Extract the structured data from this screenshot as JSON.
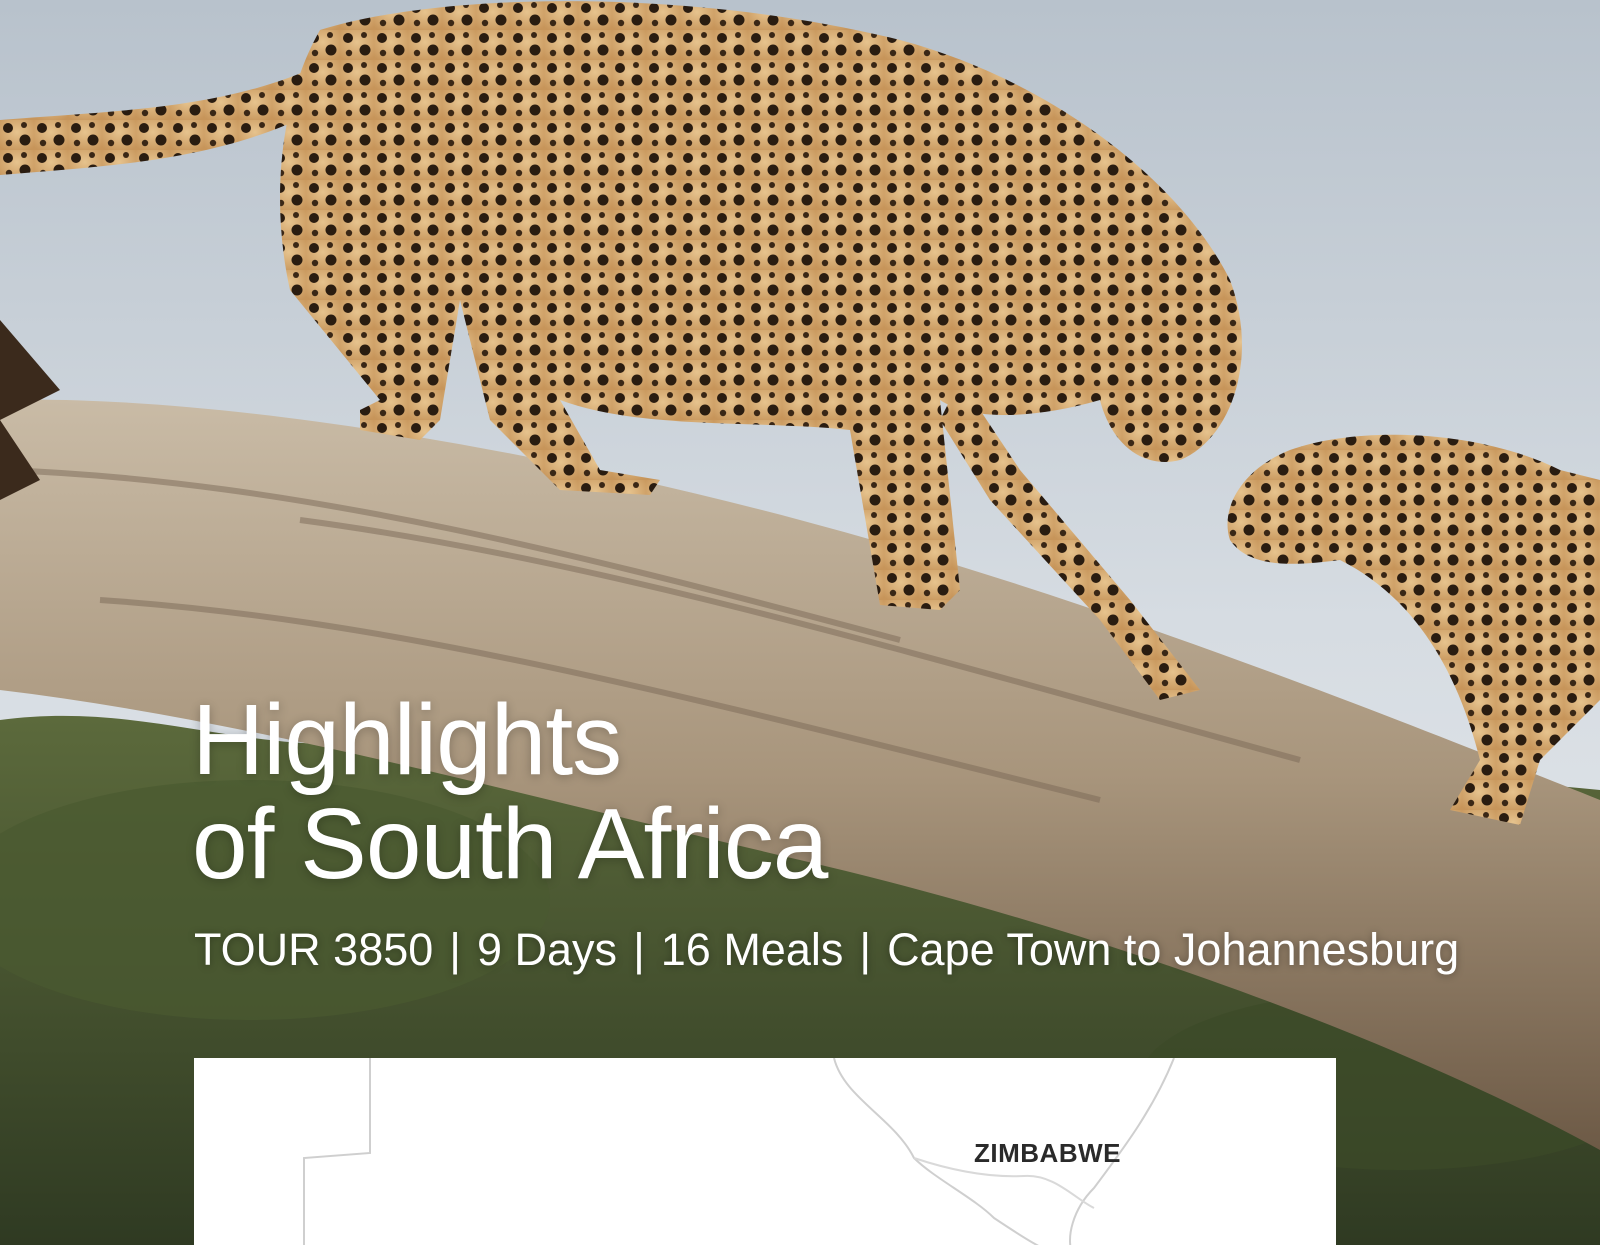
{
  "hero": {
    "title_line1": "Highlights",
    "title_line2": "of South Africa"
  },
  "tour": {
    "code": "TOUR 3850",
    "days": "9 Days",
    "meals": "16 Meals",
    "route": "Cape Town to Johannesburg",
    "separator": "|"
  },
  "map": {
    "country_label": "ZIMBABWE"
  },
  "colors": {
    "title_text": "#ffffff",
    "sky": "#c9d2dc",
    "map_background": "#ffffff"
  }
}
